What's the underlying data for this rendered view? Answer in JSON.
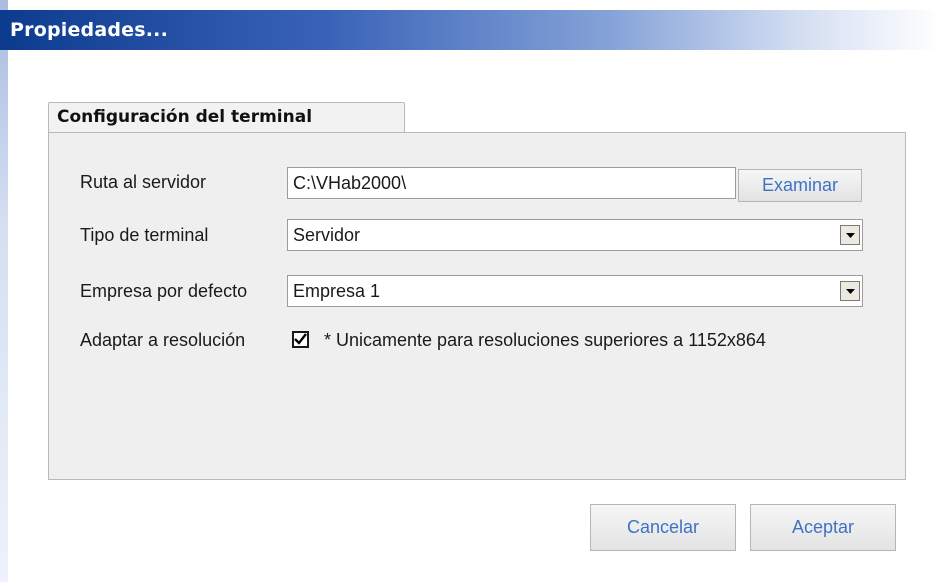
{
  "window": {
    "title": "Propiedades..."
  },
  "tab": {
    "label": "Configuración del terminal"
  },
  "fields": {
    "server_path": {
      "label": "Ruta al servidor",
      "value": "C:\\VHab2000\\",
      "browse_button": "Examinar"
    },
    "terminal_type": {
      "label": "Tipo de terminal",
      "selected": "Servidor"
    },
    "default_company": {
      "label": "Empresa por defecto",
      "selected": "Empresa 1"
    },
    "adapt_resolution": {
      "label": "Adaptar a resolución",
      "checked": true,
      "note": "* Unicamente para resoluciones superiores a 1152x864"
    }
  },
  "buttons": {
    "cancel": "Cancelar",
    "accept": "Aceptar"
  },
  "colors": {
    "title_bar_start": "#0c3b8e",
    "button_text": "#3d73c4",
    "panel_bg": "#efefef"
  },
  "icons": {
    "dropdown": "chevron-down-icon",
    "checkbox": "check-icon"
  }
}
